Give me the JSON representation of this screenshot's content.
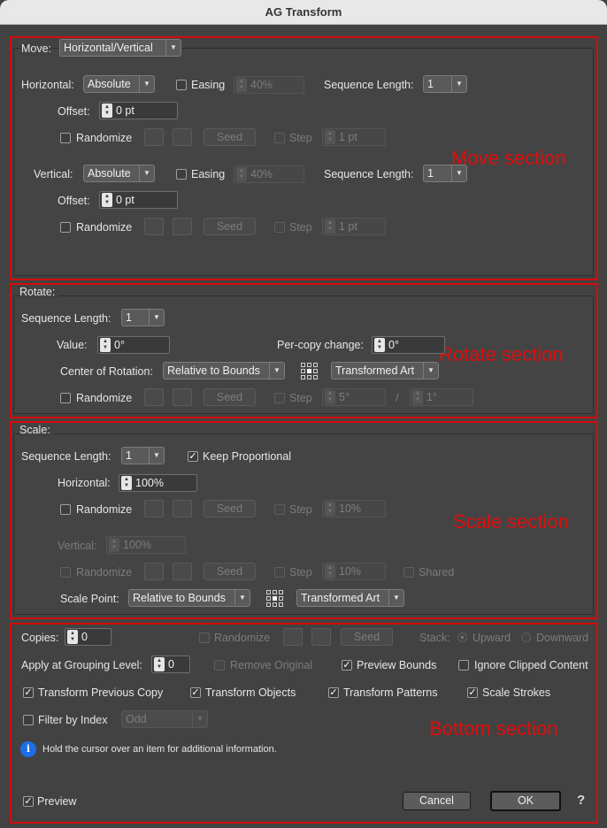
{
  "window": {
    "title": "AG Transform"
  },
  "annotations": {
    "move": "Move section",
    "rotate": "Rotate section",
    "scale": "Scale section",
    "bottom": "Bottom section"
  },
  "move": {
    "label": "Move:",
    "mode": "Horizontal/Vertical",
    "horizontal": {
      "label": "Horizontal:",
      "mode": "Absolute",
      "easing_label": "Easing",
      "easing_value": "40%",
      "seq_label": "Sequence Length:",
      "seq_value": "1",
      "offset_label": "Offset:",
      "offset_value": "0 pt",
      "randomize_label": "Randomize",
      "seed_label": "Seed",
      "step_label": "Step",
      "step_value": "1 pt"
    },
    "vertical": {
      "label": "Vertical:",
      "mode": "Absolute",
      "easing_label": "Easing",
      "easing_value": "40%",
      "seq_label": "Sequence Length:",
      "seq_value": "1",
      "offset_label": "Offset:",
      "offset_value": "0 pt",
      "randomize_label": "Randomize",
      "seed_label": "Seed",
      "step_label": "Step",
      "step_value": "1 pt"
    }
  },
  "rotate": {
    "label": "Rotate:",
    "seq_label": "Sequence Length:",
    "seq_value": "1",
    "value_label": "Value:",
    "value": "0°",
    "per_copy_label": "Per-copy change:",
    "per_copy_value": "0°",
    "center_label": "Center of Rotation:",
    "center_value": "Relative to Bounds",
    "art_value": "Transformed Art",
    "randomize_label": "Randomize",
    "seed_label": "Seed",
    "step_label": "Step",
    "step_value": "5°",
    "slash": "/",
    "step_value2": "1°"
  },
  "scale": {
    "label": "Scale:",
    "seq_label": "Sequence Length:",
    "seq_value": "1",
    "keep_proportional_label": "Keep Proportional",
    "horizontal_label": "Horizontal:",
    "horizontal_value": "100%",
    "randomize_label": "Randomize",
    "seed_label": "Seed",
    "step_label": "Step",
    "step_value": "10%",
    "vertical_label": "Vertical:",
    "vertical_value": "100%",
    "vrandomize_label": "Randomize",
    "vseed_label": "Seed",
    "vstep_label": "Step",
    "vstep_value": "10%",
    "shared_label": "Shared",
    "scale_point_label": "Scale Point:",
    "scale_point_value": "Relative to Bounds",
    "art_value": "Transformed Art"
  },
  "bottom": {
    "copies_label": "Copies:",
    "copies_value": "0",
    "randomize_label": "Randomize",
    "seed_label": "Seed",
    "stack_label": "Stack:",
    "upward_label": "Upward",
    "downward_label": "Downward",
    "grouping_label": "Apply at Grouping Level:",
    "grouping_value": "0",
    "remove_original_label": "Remove Original",
    "preview_bounds_label": "Preview Bounds",
    "ignore_clipped_label": "Ignore Clipped Content",
    "transform_prev_label": "Transform Previous Copy",
    "transform_objects_label": "Transform Objects",
    "transform_patterns_label": "Transform Patterns",
    "scale_strokes_label": "Scale Strokes",
    "filter_label": "Filter by Index",
    "filter_value": "Odd",
    "info_text": "Hold the cursor over an item for additional information.",
    "info_icon": "i",
    "preview_label": "Preview",
    "cancel_label": "Cancel",
    "ok_label": "OK",
    "help_label": "?"
  },
  "check_mark": "✓",
  "spin_up": "▲",
  "spin_down": "▼",
  "dropdown_arrow": "▼"
}
